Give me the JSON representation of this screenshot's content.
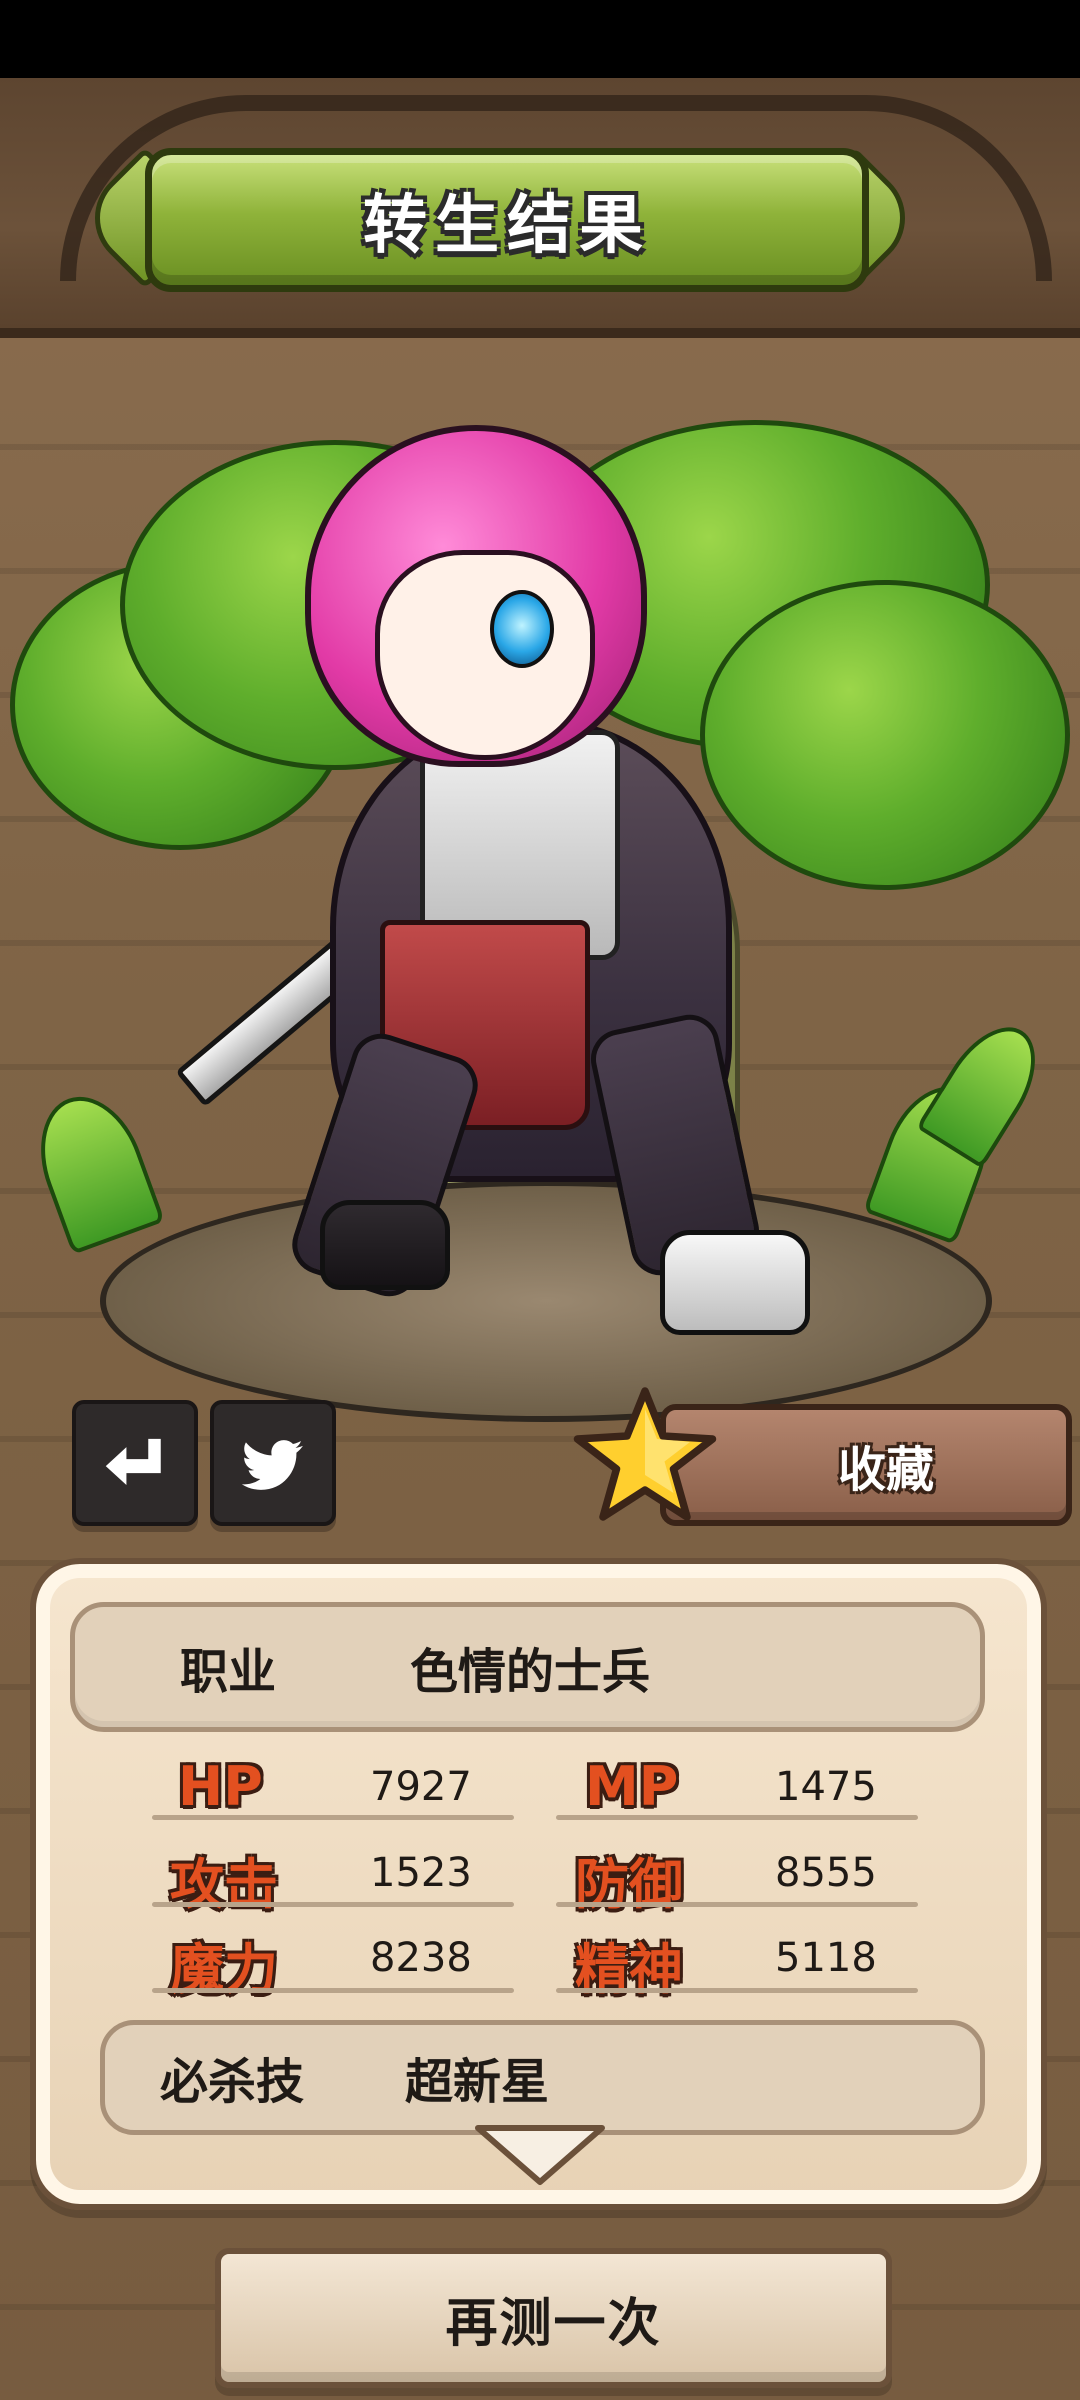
{
  "header": {
    "title": "转生结果"
  },
  "actions": {
    "share_icon": "share-arrow-icon",
    "twitter_icon": "twitter-bird-icon",
    "favorite_label": "收藏",
    "favorite_icon": "star-icon"
  },
  "result": {
    "job_label": "职业",
    "job_value": "色情的士兵",
    "stats": [
      {
        "label": "HP",
        "value": "7927"
      },
      {
        "label": "MP",
        "value": "1475"
      },
      {
        "label": "攻击",
        "value": "1523"
      },
      {
        "label": "防御",
        "value": "8555"
      },
      {
        "label": "魔力",
        "value": "8238"
      },
      {
        "label": "精神",
        "value": "5118"
      }
    ],
    "skill_label": "必杀技",
    "skill_value": "超新星"
  },
  "footer": {
    "retry_label": "再测一次"
  },
  "colors": {
    "banner_green": "#8fb33a",
    "stat_label_orange": "#e35020",
    "panel_cream": "#f6e6cf",
    "wood_dark": "#3a2418"
  }
}
